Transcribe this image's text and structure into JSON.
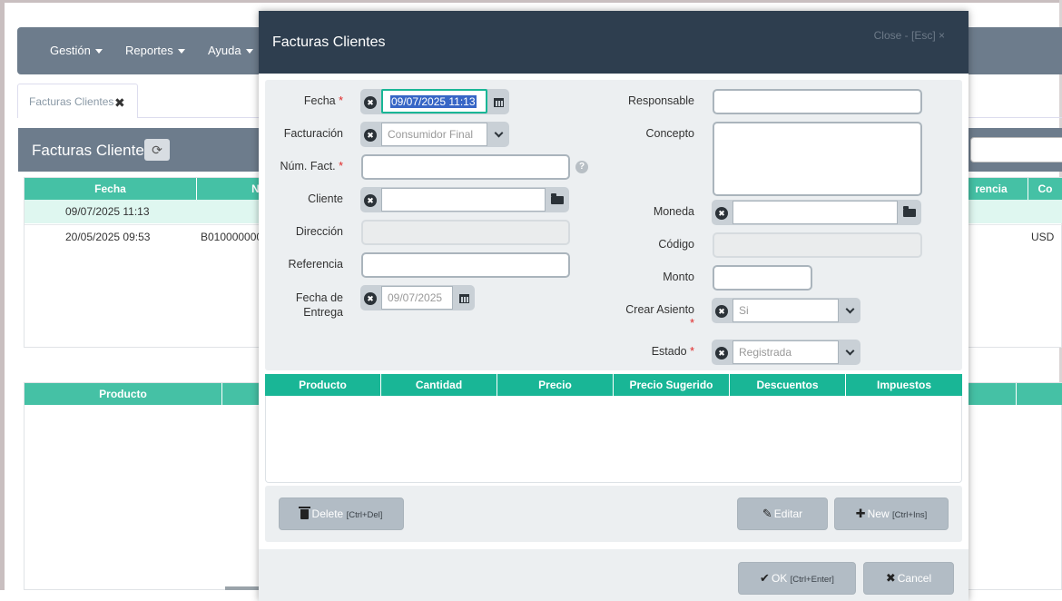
{
  "navbar": {
    "items": [
      {
        "label": "Gestión"
      },
      {
        "label": "Reportes"
      },
      {
        "label": "Ayuda"
      }
    ]
  },
  "page": {
    "tab_label": "Facturas Clientes",
    "list_title": "Facturas Clientes",
    "table": {
      "headers": [
        "Fecha",
        "N",
        "rencia",
        "Co"
      ],
      "rows": [
        {
          "fecha": "09/07/2025 11:13",
          "numero": "",
          "moneda": ""
        },
        {
          "fecha": "20/05/2025 09:53",
          "numero": "B010000000",
          "moneda": "USD"
        }
      ]
    },
    "table2": {
      "headers": [
        "Producto"
      ]
    }
  },
  "modal": {
    "title": "Facturas Clientes",
    "close_label": "Close - [Esc] ×",
    "fields": {
      "fecha": {
        "label": "Fecha",
        "value": "09/07/2025 11:13"
      },
      "facturacion": {
        "label": "Facturación",
        "value": "Consumidor Final"
      },
      "num_fact": {
        "label": "Núm. Fact.",
        "value": ""
      },
      "cliente": {
        "label": "Cliente",
        "value": ""
      },
      "direccion": {
        "label": "Dirección",
        "value": ""
      },
      "referencia": {
        "label": "Referencia",
        "value": ""
      },
      "fecha_entrega": {
        "label_1": "Fecha de",
        "label_2": "Entrega",
        "value": "09/07/2025"
      },
      "responsable": {
        "label": "Responsable",
        "value": ""
      },
      "concepto": {
        "label": "Concepto",
        "value": ""
      },
      "moneda": {
        "label": "Moneda",
        "value": ""
      },
      "codigo": {
        "label": "Código",
        "value": ""
      },
      "monto": {
        "label": "Monto",
        "value": ""
      },
      "crear_asiento": {
        "label": "Crear Asiento",
        "value": "Si"
      },
      "estado": {
        "label": "Estado",
        "value": "Registrada"
      }
    },
    "required_mark": "*",
    "help_mark": "?",
    "detail_table": {
      "headers": [
        "Producto",
        "Cantidad",
        "Precio",
        "Precio Sugerido",
        "Descuentos",
        "Impuestos"
      ]
    },
    "actions": {
      "delete": {
        "label": "Delete",
        "shortcut": "[Ctrl+Del]"
      },
      "edit": {
        "label": "Editar"
      },
      "new": {
        "label": "New",
        "shortcut": "[Ctrl+Ins]"
      },
      "ok": {
        "label": "OK",
        "shortcut": "[Ctrl+Enter]"
      },
      "cancel": {
        "label": "Cancel"
      }
    }
  },
  "colors": {
    "navbar": "#6d7c8c",
    "modal_header": "#2e3e4f",
    "table_header": "#19b696",
    "bg_table_header": "#45c1a5",
    "selection": "#3766c6"
  }
}
